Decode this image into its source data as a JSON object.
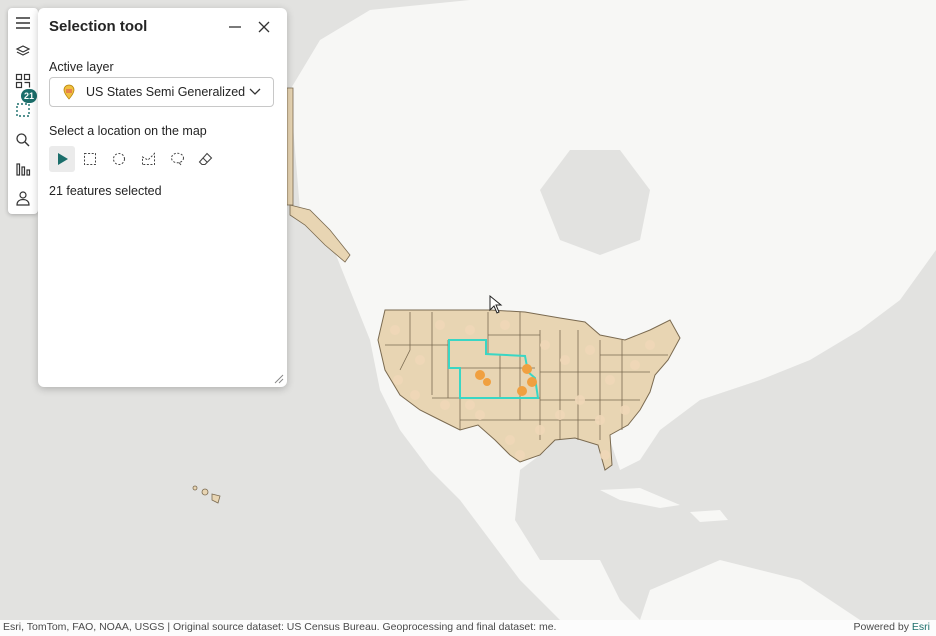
{
  "panel": {
    "title": "Selection tool",
    "active_layer_label": "Active layer",
    "layer_name": "US States Semi Generalized",
    "instruction": "Select a location on the map",
    "status": "21 features selected"
  },
  "toolbar": {
    "selection_count": "21",
    "items": [
      "menu-icon",
      "layers-icon",
      "qr-icon",
      "selection-icon",
      "search-icon",
      "chart-icon",
      "user-icon"
    ]
  },
  "tools": [
    "point-select-icon",
    "rectangle-select-icon",
    "circle-select-icon",
    "polygon-select-icon",
    "lasso-select-icon",
    "eraser-icon"
  ],
  "footer": {
    "attribution": "Esri, TomTom, FAO, NOAA, USGS | Original source dataset: US Census Bureau. Geoprocessing and final dataset: me.",
    "powered_by": "Powered by",
    "powered_brand": "Esri"
  },
  "colors": {
    "land": "#f7f7f5",
    "water": "#e2e2e0",
    "states_fill": "#e8d5b3",
    "state_border": "#7a6a50",
    "selection": "#3ad6c4",
    "points": "#f0a040",
    "accent": "#1b6e6b"
  }
}
